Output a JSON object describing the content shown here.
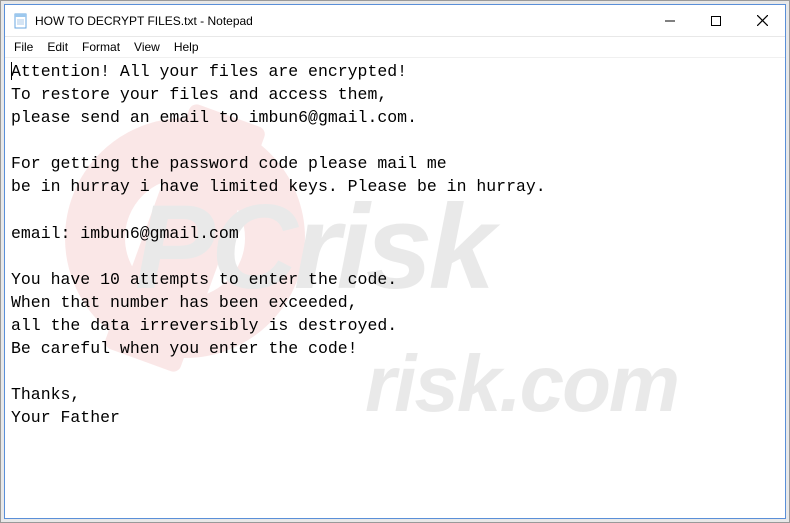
{
  "window": {
    "title": "HOW TO DECRYPT FILES.txt - Notepad",
    "icon": "notepad-icon"
  },
  "controls": {
    "minimize": "minimize",
    "maximize": "maximize",
    "close": "close"
  },
  "menu": {
    "file": "File",
    "edit": "Edit",
    "format": "Format",
    "view": "View",
    "help": "Help"
  },
  "document": {
    "text": "Attention! All your files are encrypted!\nTo restore your files and access them,\nplease send an email to imbun6@gmail.com.\n\nFor getting the password code please mail me\nbe in hurray i have limited keys. Please be in hurray.\n\nemail: imbun6@gmail.com\n\nYou have 10 attempts to enter the code.\nWhen that number has been exceeded,\nall the data irreversibly is destroyed.\nBe careful when you enter the code!\n\nThanks,\nYour Father"
  },
  "watermark": {
    "line1": "PCrisk",
    "line2": "risk.com"
  }
}
